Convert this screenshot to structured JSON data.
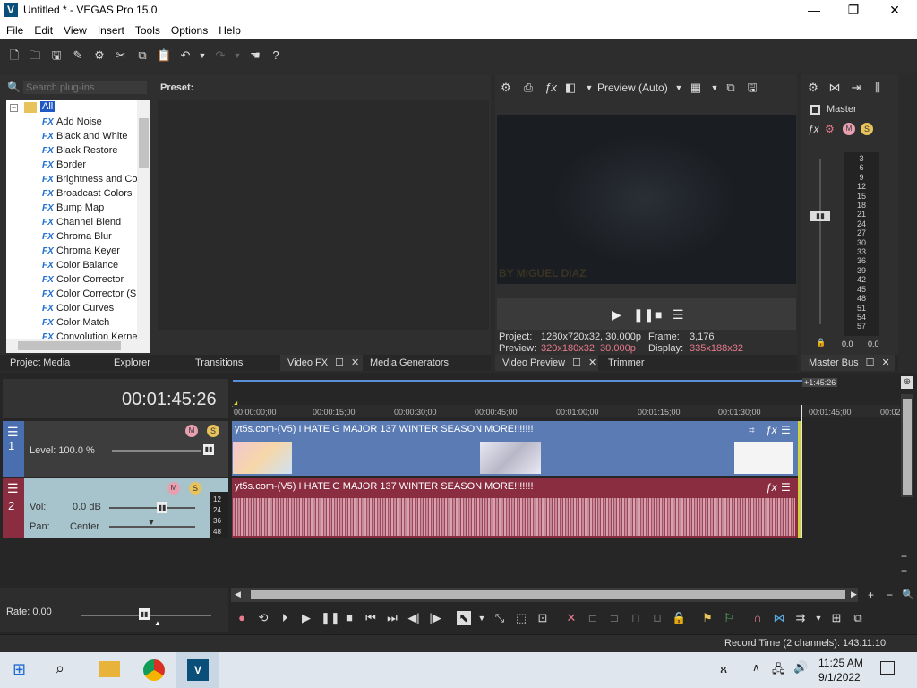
{
  "window": {
    "title": "Untitled * - VEGAS Pro 15.0",
    "app_icon_letter": "V",
    "minimize": "—",
    "maximize": "❐",
    "close": "✕"
  },
  "menu": [
    "File",
    "Edit",
    "View",
    "Insert",
    "Tools",
    "Options",
    "Help"
  ],
  "plugin_panel": {
    "search_placeholder": "Search plug-ins",
    "preset_label": "Preset:",
    "root_label": "All",
    "fx_badge": "FX",
    "items": [
      "Add Noise",
      "Black and White",
      "Black Restore",
      "Border",
      "Brightness and Co",
      "Broadcast Colors",
      "Bump Map",
      "Channel Blend",
      "Chroma Blur",
      "Chroma Keyer",
      "Color Balance",
      "Color Corrector",
      "Color Corrector (S",
      "Color Curves",
      "Color Match",
      "Convolution Kernel"
    ]
  },
  "left_tabs": [
    "Project Media",
    "Explorer",
    "Transitions",
    "Video FX",
    "Media Generators"
  ],
  "video_preview": {
    "mode": "Preview (Auto)",
    "overlay_text": "BY MIGUEL DIAZ",
    "project_label": "Project:",
    "project_value": "1280x720x32, 30.000p",
    "frame_label": "Frame:",
    "frame_value": "3,176",
    "preview_label": "Preview:",
    "preview_value": "320x180x32, 30.000p",
    "display_label": "Display:",
    "display_value": "335x188x32",
    "tabs": [
      "Video Preview",
      "Trimmer"
    ]
  },
  "master_bus": {
    "label": "Master",
    "db_scale": [
      "3",
      "6",
      "9",
      "12",
      "15",
      "18",
      "21",
      "24",
      "27",
      "30",
      "33",
      "36",
      "39",
      "42",
      "45",
      "48",
      "51",
      "54",
      "57"
    ],
    "peak_left": "0.0",
    "peak_right": "0.0",
    "tab": "Master Bus"
  },
  "timeline": {
    "timecode": "00:01:45:26",
    "end_marker": "+1:45:26",
    "ruler": [
      "00:00:00;00",
      "00:00:15;00",
      "00:00:30;00",
      "00:00:45;00",
      "00:01:00;00",
      "00:01:15;00",
      "00:01:30;00",
      "00:01:45;00",
      "00:02"
    ],
    "video_track": {
      "number": "1",
      "level": "Level: 100.0 %",
      "clip_title": "yt5s.com-(V5) I HATE G MAJOR 137 WINTER SEASON MORE!!!!!!!"
    },
    "audio_track": {
      "number": "2",
      "vol_label": "Vol:",
      "vol_value": "0.0 dB",
      "pan_label": "Pan:",
      "pan_value": "Center",
      "db_marks": [
        "12",
        "24",
        "36",
        "48"
      ],
      "clip_title": "yt5s.com-(V5) I HATE G MAJOR 137 WINTER SEASON MORE!!!!!!!"
    },
    "rate": "Rate: 0.00"
  },
  "status": {
    "record_time": "Record Time (2 channels): 143:11:10"
  },
  "taskbar": {
    "time": "11:25 AM",
    "date": "9/1/2022"
  }
}
